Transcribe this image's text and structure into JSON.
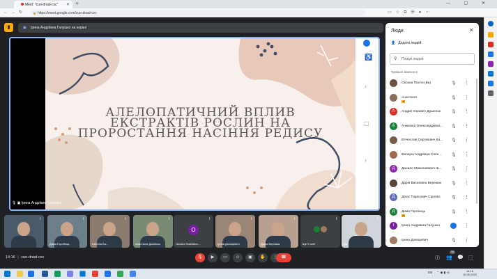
{
  "browser": {
    "tab_title": "Meet: \"cuo-dnad-cxc\"",
    "url": "https://meet.google.com/cuo-dnad-cxc",
    "new_tab_symbol": "+",
    "window_controls": "— ▢ ✕"
  },
  "meet": {
    "presenting_banner": "Ірина Андріївна Галушко на екрані",
    "presenter_caption": "Ірина Андріївна Галушко",
    "meeting_code": "cuo-dnad-cxc",
    "time": "14:16",
    "participants_badge": "10"
  },
  "slide": {
    "title_lines": [
      "АЛЕЛОПАТИЧНИЙ ВПЛИВ",
      "ЕКСТРАКТІВ РОСЛИН НА",
      "ПРОРОСТАННЯ НАСІННЯ РЕДИСУ"
    ]
  },
  "people_panel": {
    "title": "Люди",
    "add_people": "Додати людей",
    "search_placeholder": "Пошук людей",
    "section_label": "Тривале вивчення",
    "participants": [
      {
        "name": "Оксана Пасло (Ви)",
        "initial": "",
        "color": "#6b4f3f",
        "host": false
      },
      {
        "name": "Анастасія",
        "initial": "",
        "color": "#8a6d5a",
        "host": true
      },
      {
        "name": "Андрій Ігорович Душенок",
        "initial": "А",
        "color": "#d93025",
        "host": false
      },
      {
        "name": "Анжеліка Олександрівна...",
        "initial": "А",
        "color": "#188038",
        "host": false
      },
      {
        "name": "В'ячеслав Сергійович Ка...",
        "initial": "",
        "color": "#7a5c4a",
        "host": false
      },
      {
        "name": "Валерія Андріївна Сопе...",
        "initial": "",
        "color": "#9c6b4d",
        "host": false
      },
      {
        "name": "Данило Миколайович Ів...",
        "initial": "Д",
        "color": "#8e24aa",
        "host": false
      },
      {
        "name": "Дарія Василівна Вережак",
        "initial": "",
        "color": "#5a4438",
        "host": false
      },
      {
        "name": "Деніс Тарасович Сіренко",
        "initial": "Д",
        "color": "#5c6bc0",
        "host": false
      },
      {
        "name": "Дима Горобець",
        "initial": "Д",
        "color": "#188038",
        "host": true
      },
      {
        "name": "Ірина Андріївна Галушко",
        "initial": "І",
        "color": "#7b1fa2",
        "host": false
      },
      {
        "name": "Ірина Доміщевич",
        "initial": "",
        "color": "#a07a60",
        "host": false
      }
    ]
  },
  "thumbnails": [
    {
      "name": "",
      "bg": "#4a5a6a"
    },
    {
      "name": "Дима Горобець",
      "bg": "#6d7f8a"
    },
    {
      "name": "Євгенія Ба...",
      "bg": "#8a7b6e"
    },
    {
      "name": "Анастасія Домінськ",
      "bg": "#7a8a74"
    },
    {
      "name": "Оксана Павлівна...",
      "bg": "#3c4043",
      "initial": "О"
    },
    {
      "name": "Ірина Доміщевич",
      "bg": "#9a8576"
    },
    {
      "name": "Дарія Вережак",
      "bg": "#b8a090"
    },
    {
      "name": "Ще 9 осіб",
      "bg": "#3c4043"
    },
    {
      "name": "Ви",
      "bg": "#cfd5da"
    }
  ],
  "taskbar": {
    "lang": "EN",
    "time": "14:16",
    "date": "16.05.2023"
  },
  "colors": {
    "meet_bg": "#202124",
    "accent_blue": "#8ab4f8",
    "end_call_red": "#ea4335",
    "host_badge": "#f9ab00"
  }
}
